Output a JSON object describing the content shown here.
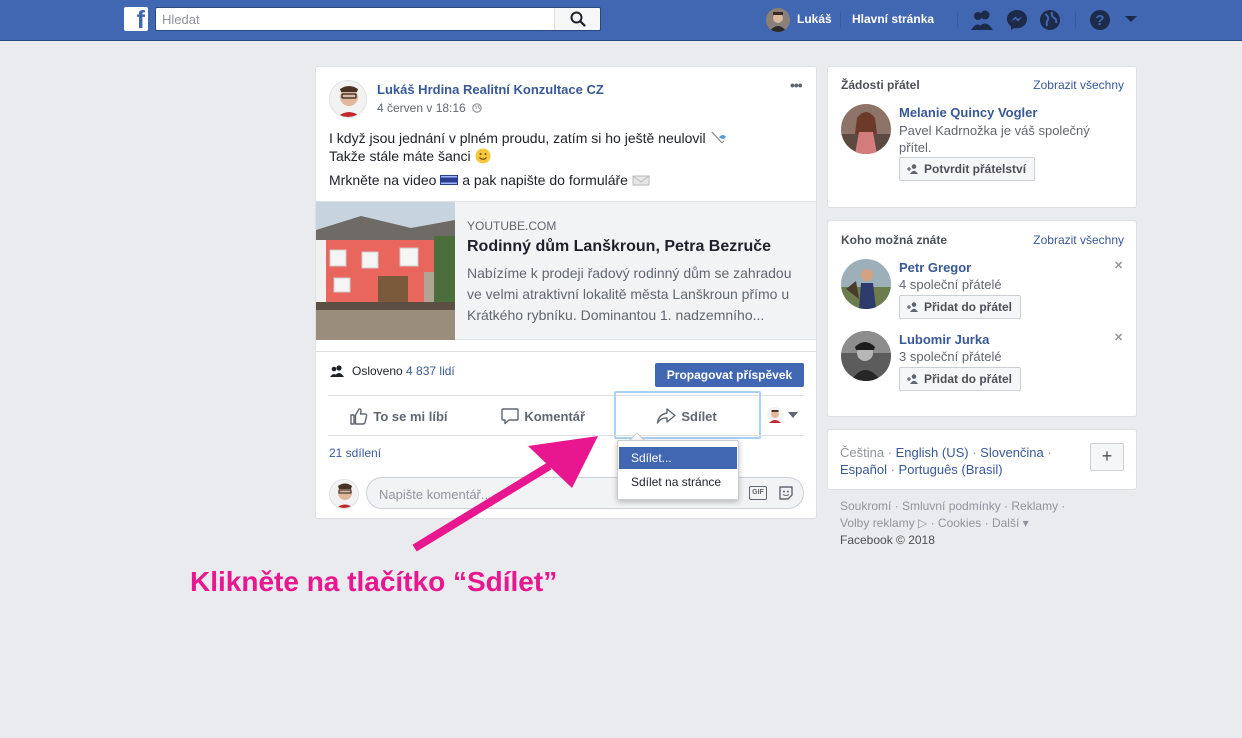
{
  "topbar": {
    "logo": "f",
    "search_placeholder": "Hledat",
    "user_name": "Lukáš",
    "home_label": "Hlavní stránka"
  },
  "post": {
    "page_name": "Lukáš Hrdina Realitní Konzultace CZ",
    "date": "4 červen v 18:16",
    "more_icon": "•••",
    "text_line1": "I když jsou jednání v plném proudu, zatím si ho ještě neulovil",
    "text_line2": "Takže stále máte šanci",
    "text_line3a": "Mrkněte na video",
    "text_line3b": "a pak napište do formuláře",
    "link": {
      "source": "YOUTUBE.COM",
      "title": "Rodinný dům Lanškroun, Petra Bezruče",
      "desc_line1": "Nabízíme k prodeji řadový rodinný dům se zahradou",
      "desc_line2": "ve velmi atraktivní lokalitě města Lanškroun přímo u",
      "desc_line3": "Krátkého rybníku. Dominantou 1. nadzemního..."
    },
    "reach_prefix": "Osloveno",
    "reach_count": "4 837 lidí",
    "promote_label": "Propagovat příspěvek",
    "like_label": "To se mi líbí",
    "comment_label": "Komentář",
    "share_label": "Sdílet",
    "shares_count": "21 sdílení",
    "comment_placeholder": "Napište komentář...",
    "gif_label": "GIF"
  },
  "share_menu": {
    "items": [
      "Sdílet...",
      "Sdílet na stránce"
    ]
  },
  "friend_requests": {
    "title": "Žádosti přátel",
    "see_all": "Zobrazit všechny",
    "name": "Melanie Quincy Vogler",
    "mutual_line1": "Pavel Kadrnožka je váš společný",
    "mutual_line2": "přítel.",
    "confirm_label": "Potvrdit přátelství"
  },
  "people_you_may_know": {
    "title": "Koho možná znáte",
    "see_all": "Zobrazit všechny",
    "people": [
      {
        "name": "Petr Gregor",
        "mutual": "4 společní přátelé",
        "add_label": "Přidat do přátel"
      },
      {
        "name": "Lubomir Jurka",
        "mutual": "3 společní přátelé",
        "add_label": "Přidat do přátel"
      }
    ]
  },
  "languages": {
    "items": [
      "Čeština",
      "English (US)",
      "Slovenčina",
      "Español",
      "Português (Brasil)"
    ],
    "add": "+"
  },
  "footer": {
    "line1": "Soukromí · Smluvní podmínky · Reklamy ·",
    "line2": "Volby reklamy ▷ · Cookies · Další ▾",
    "line3": "Facebook © 2018"
  },
  "annotation": "Klikněte na tlačítko “Sdílet”",
  "colors": {
    "brand": "#4267b2",
    "link": "#385898",
    "annotation": "#e8168f",
    "highlight_box": "#a8d1f5"
  }
}
